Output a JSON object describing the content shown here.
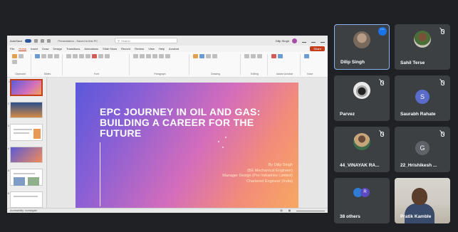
{
  "powerpoint": {
    "titlebar": {
      "autosave": "AutoSave",
      "file_name": "Presentation - Saved to this PC",
      "search_placeholder": "Search",
      "user": "Dilip Singh"
    },
    "menu_tabs": [
      "File",
      "Home",
      "Insert",
      "Draw",
      "Design",
      "Transitions",
      "Animations",
      "Slide Show",
      "Record",
      "Review",
      "View",
      "Help",
      "Acrobat"
    ],
    "active_tab": "Home",
    "share_label": "Share",
    "ribbon_groups": [
      "Clipboard",
      "Slides",
      "Font",
      "Paragraph",
      "Drawing",
      "Editing",
      "Adobe Acrobat",
      "Voice"
    ],
    "slide": {
      "title": "EPC JOURNEY IN OIL AND GAS: BUILDING A CAREER FOR THE FUTURE",
      "byline": [
        "By Dilip Singh",
        "(BE Mechanical Engineer)",
        "Manager Design (Pro Industries Limited)",
        "Chartered Engineer (India)"
      ]
    },
    "status": {
      "accessibility": "Accessibility: Investigate"
    }
  },
  "participants": [
    {
      "name": "Dilip Singh",
      "kind": "photo",
      "muted": false,
      "active": true
    },
    {
      "name": "Sahil Terse",
      "kind": "photo",
      "muted": true
    },
    {
      "name": "Parvez",
      "kind": "photo",
      "muted": true
    },
    {
      "name": "Saurabh Rahate",
      "kind": "letter",
      "letter": "S",
      "color": "#5b6bc9",
      "muted": true
    },
    {
      "name": "44_VINAYAK RA...",
      "kind": "photo",
      "muted": true
    },
    {
      "name": "22_Hrishikesh ...",
      "kind": "letter",
      "letter": "G",
      "color": "#5f6368",
      "muted": true
    },
    {
      "name": "38 others",
      "kind": "others",
      "letter": "R"
    },
    {
      "name": "Pratik Kamble",
      "kind": "camera"
    }
  ]
}
